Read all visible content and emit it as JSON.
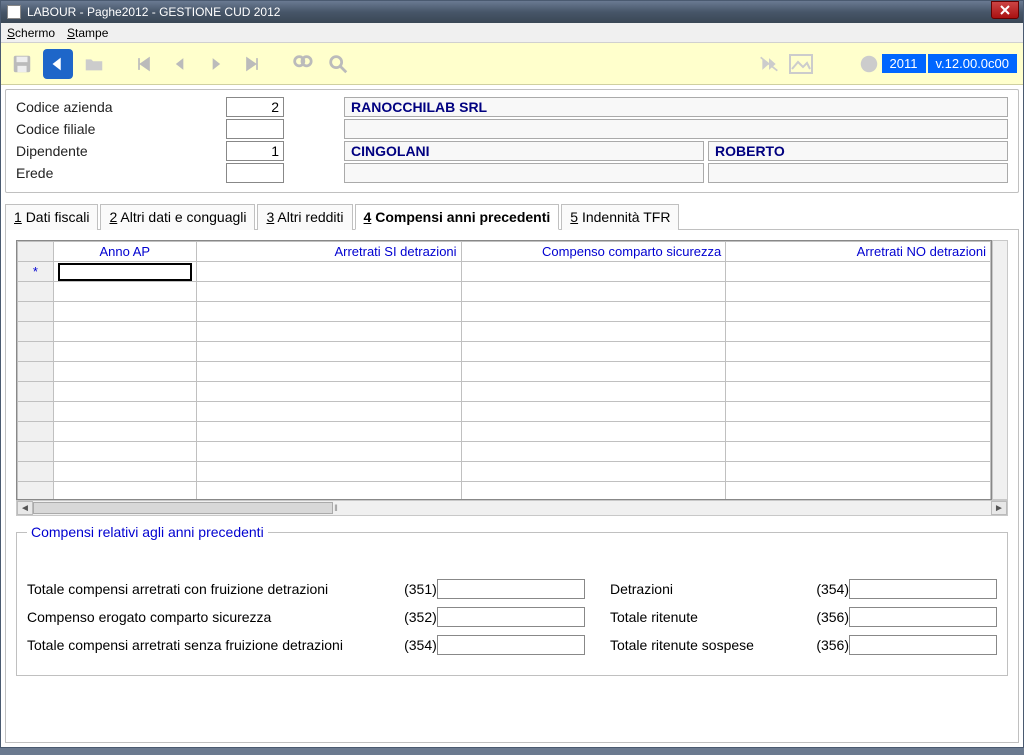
{
  "window": {
    "title": "LABOUR - Paghe2012 - GESTIONE CUD 2012"
  },
  "menu": {
    "schermo": "Schermo",
    "stampe": "Stampe"
  },
  "status": {
    "year": "2011",
    "version": "v.12.00.0c00"
  },
  "header": {
    "codice_azienda_label": "Codice azienda",
    "codice_azienda_value": "2",
    "codice_azienda_name": "RANOCCHILAB SRL",
    "codice_filiale_label": "Codice filiale",
    "codice_filiale_value": "",
    "codice_filiale_name": "",
    "dipendente_label": "Dipendente",
    "dipendente_value": "1",
    "dipendente_surname": "CINGOLANI",
    "dipendente_name": "ROBERTO",
    "erede_label": "Erede",
    "erede_value": "",
    "erede_name1": "",
    "erede_name2": ""
  },
  "tabs": {
    "t1": "Dati fiscali",
    "t2": "Altri dati e conguagli",
    "t3": "Altri redditi",
    "t4": "Compensi anni precedenti",
    "t5": "Indennità TFR"
  },
  "grid": {
    "col_rowmark": "*",
    "col_anno": "Anno AP",
    "col_arr_si": "Arretrati SI detrazioni",
    "col_comp_sic": "Compenso comparto sicurezza",
    "col_arr_no": "Arretrati NO detrazioni",
    "rows": 12
  },
  "fieldset": {
    "legend": "Compensi relativi agli anni precedenti",
    "row1_label": "Totale compensi arretrati con fruizione detrazioni",
    "row1_code": "(351)",
    "row1_label2": "Detrazioni",
    "row1_code2": "(354)",
    "row2_label": "Compenso erogato comparto sicurezza",
    "row2_code": "(352)",
    "row2_label2": "Totale ritenute",
    "row2_code2": "(356)",
    "row3_label": "Totale compensi arretrati senza fruizione detrazioni",
    "row3_code": "(354)",
    "row3_label2": "Totale ritenute sospese",
    "row3_code2": "(356)"
  }
}
